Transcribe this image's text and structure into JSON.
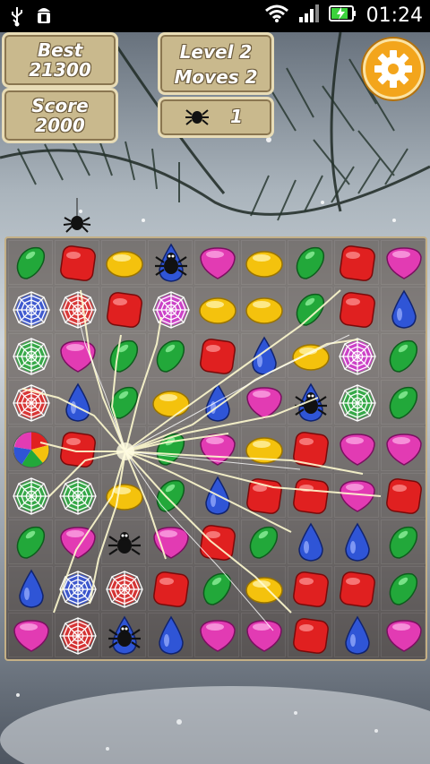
{
  "status_bar": {
    "time": "01:24",
    "icons": [
      "usb-icon",
      "android-debug-icon",
      "wifi-icon",
      "signal-icon",
      "battery-charging-icon"
    ]
  },
  "hud": {
    "best_label": "Best",
    "best_value": "21300",
    "score_label": "Score",
    "score_value": "2000",
    "level_label": "Level 2",
    "moves_label": "Moves 2",
    "spider_count": "1"
  },
  "colors": {
    "panel_bg": "#c9b98d",
    "panel_border": "#e8dcb6",
    "gear": "#f3a51c",
    "green": "#22a83a",
    "red": "#e02020",
    "yellow": "#f4c20d",
    "pink": "#e23bb3",
    "blue": "#2f55d6",
    "web_red": "#e23030",
    "web_green": "#2fae44",
    "web_blue": "#3956d8",
    "web_pink": "#d43ccf"
  },
  "board": {
    "rows": 9,
    "cols": 9,
    "grid": [
      [
        "green",
        "red",
        "yellow",
        "spider-blue",
        "pink",
        "yellow",
        "green",
        "red",
        "pink"
      ],
      [
        "web-blue",
        "web-red",
        "red",
        "web-pink",
        "yellow",
        "yellow",
        "green",
        "red",
        "blue"
      ],
      [
        "web-green",
        "pink",
        "green",
        "green",
        "red",
        "blue",
        "yellow",
        "web-pink",
        "green"
      ],
      [
        "web-red",
        "blue",
        "green",
        "yellow",
        "blue",
        "pink",
        "spider-blue",
        "web-green",
        "green"
      ],
      [
        "rainbow",
        "red",
        "empty",
        "green",
        "pink",
        "yellow",
        "red",
        "pink",
        "pink"
      ],
      [
        "web-green",
        "web-green",
        "yellow",
        "green",
        "blue",
        "red",
        "red",
        "pink",
        "red"
      ],
      [
        "green",
        "pink",
        "spider-green",
        "pink",
        "red",
        "green",
        "blue",
        "blue",
        "green"
      ],
      [
        "blue",
        "web-blue",
        "web-red",
        "red",
        "green",
        "yellow",
        "red",
        "red",
        "green"
      ],
      [
        "pink",
        "web-red",
        "spider-blue",
        "blue",
        "pink",
        "pink",
        "red",
        "blue",
        "pink"
      ]
    ]
  }
}
